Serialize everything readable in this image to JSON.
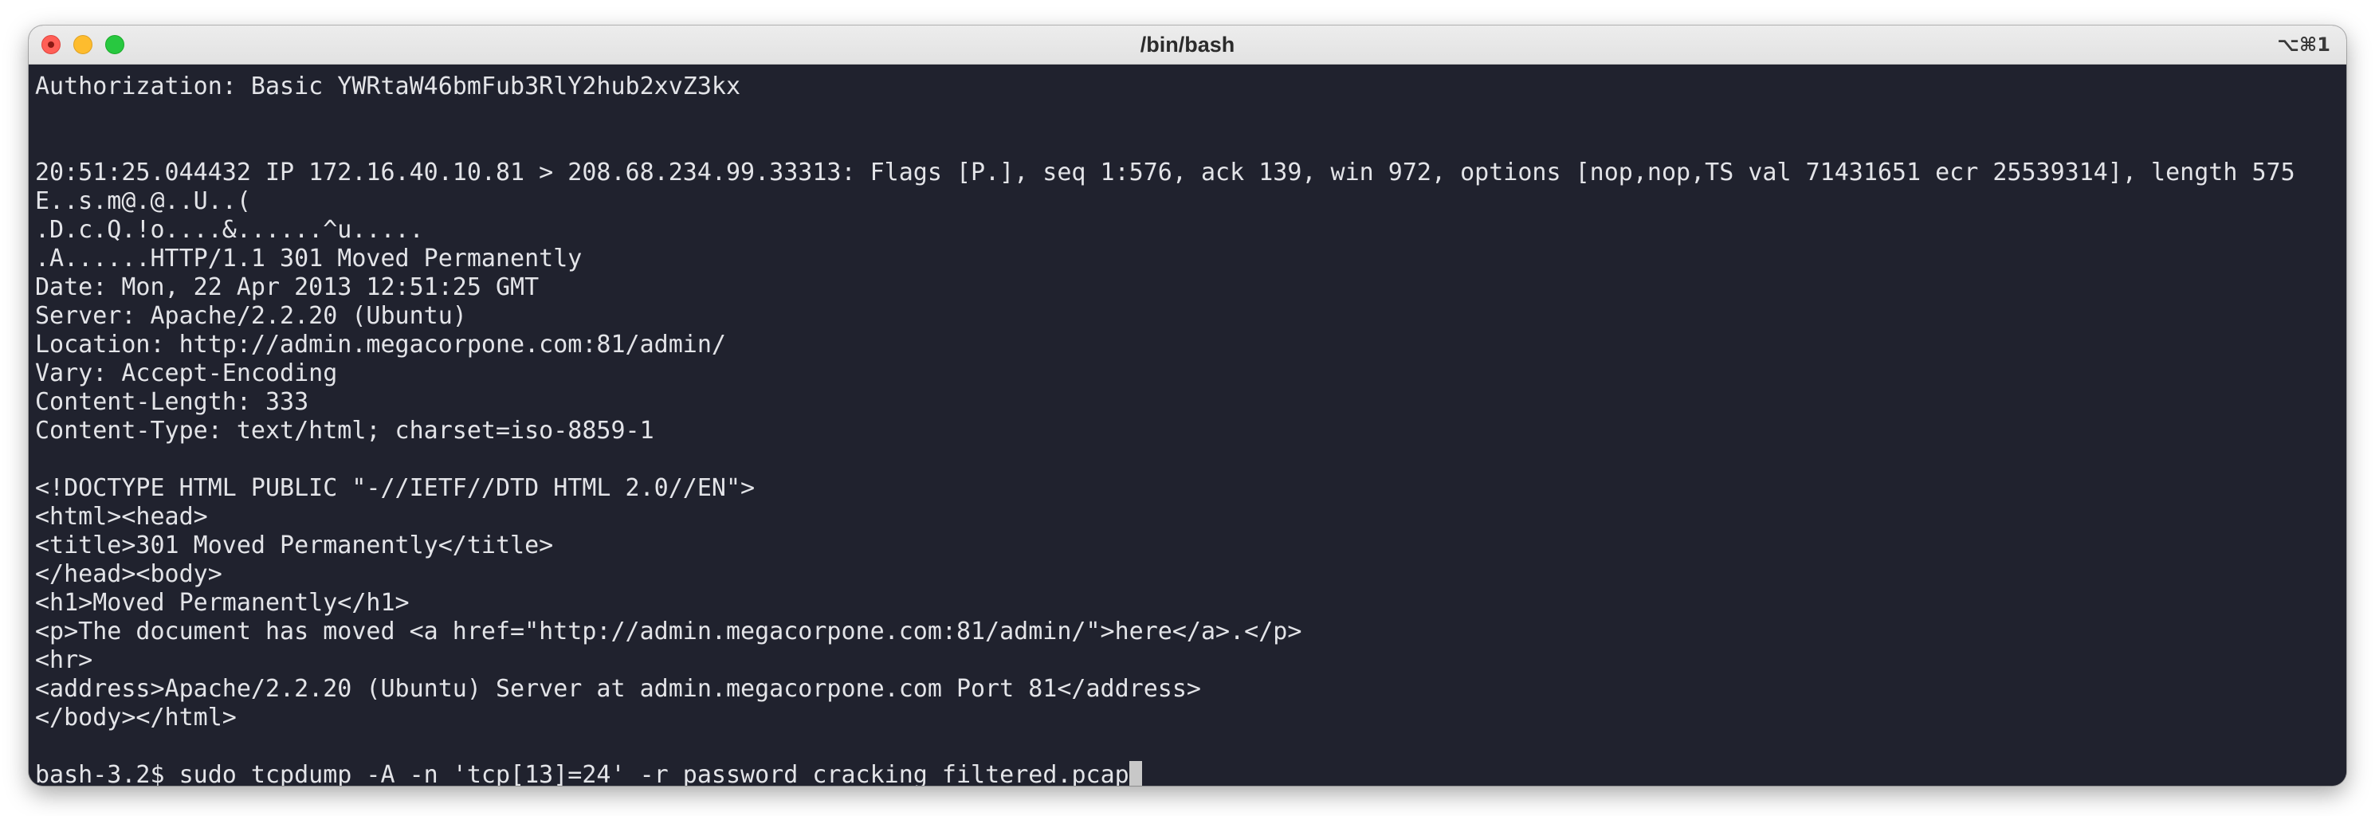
{
  "window": {
    "title": "/bin/bash",
    "shortcut": "⌥⌘1"
  },
  "terminal": {
    "lines": [
      "Authorization: Basic YWRtaW46bmFub3RlY2hub2xvZ3kx",
      "",
      "",
      "20:51:25.044432 IP 172.16.40.10.81 > 208.68.234.99.33313: Flags [P.], seq 1:576, ack 139, win 972, options [nop,nop,TS val 71431651 ecr 25539314], length 575",
      "E..s.m@.@..U..(",
      ".D.c.Q.!o....&......^u.....",
      ".A......HTTP/1.1 301 Moved Permanently",
      "Date: Mon, 22 Apr 2013 12:51:25 GMT",
      "Server: Apache/2.2.20 (Ubuntu)",
      "Location: http://admin.megacorpone.com:81/admin/",
      "Vary: Accept-Encoding",
      "Content-Length: 333",
      "Content-Type: text/html; charset=iso-8859-1",
      "",
      "<!DOCTYPE HTML PUBLIC \"-//IETF//DTD HTML 2.0//EN\">",
      "<html><head>",
      "<title>301 Moved Permanently</title>",
      "</head><body>",
      "<h1>Moved Permanently</h1>",
      "<p>The document has moved <a href=\"http://admin.megacorpone.com:81/admin/\">here</a>.</p>",
      "<hr>",
      "<address>Apache/2.2.20 (Ubuntu) Server at admin.megacorpone.com Port 81</address>",
      "</body></html>",
      ""
    ],
    "prompt": "bash-3.2$ ",
    "command": "sudo tcpdump -A -n 'tcp[13]=24' -r password_cracking_filtered.pcap"
  }
}
